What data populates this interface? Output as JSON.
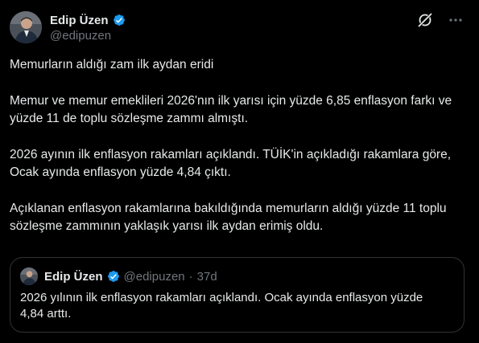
{
  "author": {
    "display_name": "Edip Üzen",
    "handle": "@edipuzen"
  },
  "icons": {
    "verified": "verified-badge-icon",
    "grok": "grok-icon",
    "more": "more-options-icon"
  },
  "colors": {
    "background": "#000000",
    "text": "#e7e9ea",
    "secondary_text": "#71767b",
    "verified_blue": "#1d9bf0",
    "border": "#2f3336"
  },
  "tweet": {
    "paragraphs": [
      "Memurların aldığı zam ilk aydan eridi",
      "Memur ve memur emeklileri 2026'nın ilk yarısı için yüzde 6,85 enflasyon farkı ve yüzde 11 de toplu sözleşme zammı almıştı.",
      "2026 ayının ilk enflasyon rakamları açıklandı. TÜİK'in açıkladığı rakamlara göre, Ocak ayında enflasyon yüzde 4,84 çıktı.",
      "Açıklanan enflasyon rakamlarına bakıldığında memurların aldığı yüzde 11 toplu sözleşme zammının yaklaşık yarısı ilk aydan erimiş oldu."
    ]
  },
  "quote": {
    "display_name": "Edip Üzen",
    "handle": "@edipuzen",
    "separator": "·",
    "time": "37d",
    "text": "2026 yılının ilk enflasyon rakamları açıklandı. Ocak ayında enflasyon yüzde 4,84 arttı."
  }
}
